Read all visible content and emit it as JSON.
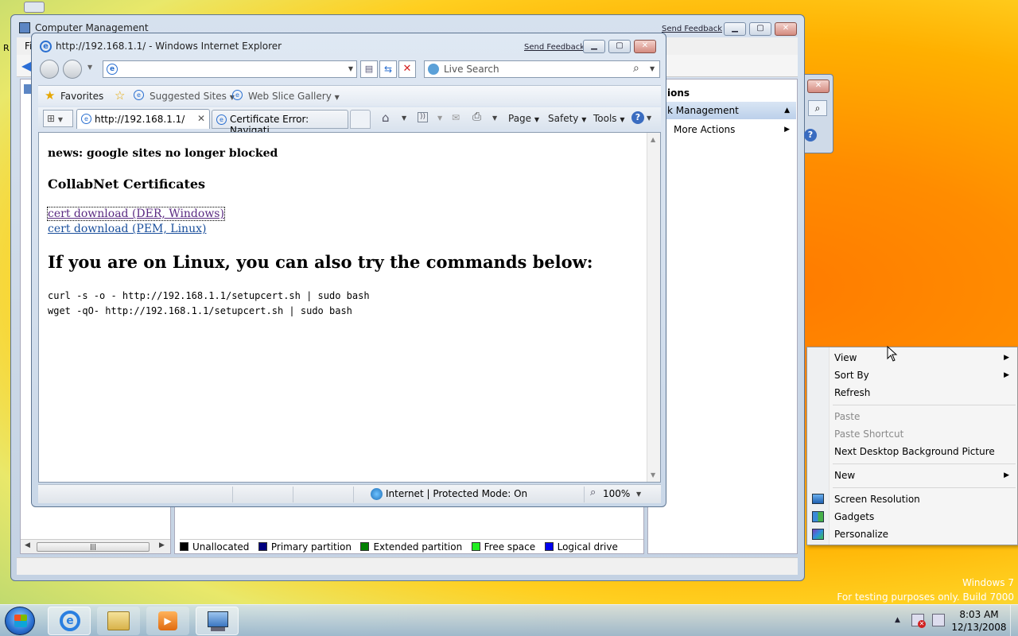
{
  "cm_window": {
    "title": "Computer Management",
    "send_feedback": "Send Feedback",
    "menu_first": "Fi",
    "actions_title": "ions",
    "actions_section": "k Management",
    "more_actions": "More Actions",
    "legend": [
      {
        "label": "Unallocated",
        "color": "#000000"
      },
      {
        "label": "Primary partition",
        "color": "#000080"
      },
      {
        "label": "Extended partition",
        "color": "#008000"
      },
      {
        "label": "Free space",
        "color": "#22ee22"
      },
      {
        "label": "Logical drive",
        "color": "#0000ee"
      }
    ]
  },
  "ie_window": {
    "title": "http://192.168.1.1/ - Windows Internet Explorer",
    "send_feedback": "Send Feedback",
    "search_placeholder": "Live Search",
    "favorites": "Favorites",
    "suggested_sites": "Suggested Sites",
    "web_slice_gallery": "Web Slice Gallery",
    "tabs": [
      {
        "label": "http://192.168.1.1/"
      },
      {
        "label": "Certificate Error: Navigati..."
      }
    ],
    "cmd": {
      "page": "Page",
      "safety": "Safety",
      "tools": "Tools"
    },
    "status_zone": "Internet | Protected Mode: On",
    "zoom": "100%"
  },
  "page": {
    "news": "news: google sites no longer blocked",
    "heading": "CollabNet Certificates",
    "link_der": "cert download (DER, Windows)",
    "link_pem": "cert download (PEM, Linux)",
    "linux_heading": "If you are on Linux, you can also try the commands below:",
    "cmd1": "curl -s -o - http://192.168.1.1/setupcert.sh | sudo bash",
    "cmd2": "wget -qO- http://192.168.1.1/setupcert.sh | sudo bash"
  },
  "context_menu": {
    "view": "View",
    "sort_by": "Sort By",
    "refresh": "Refresh",
    "paste": "Paste",
    "paste_shortcut": "Paste Shortcut",
    "next_bg": "Next Desktop Background Picture",
    "new": "New",
    "screen_resolution": "Screen Resolution",
    "gadgets": "Gadgets",
    "personalize": "Personalize"
  },
  "watermark": {
    "line1": "Windows 7",
    "line2": "For testing purposes only. Build 7000"
  },
  "taskbar": {
    "time": "8:03 AM",
    "date": "12/13/2008"
  }
}
